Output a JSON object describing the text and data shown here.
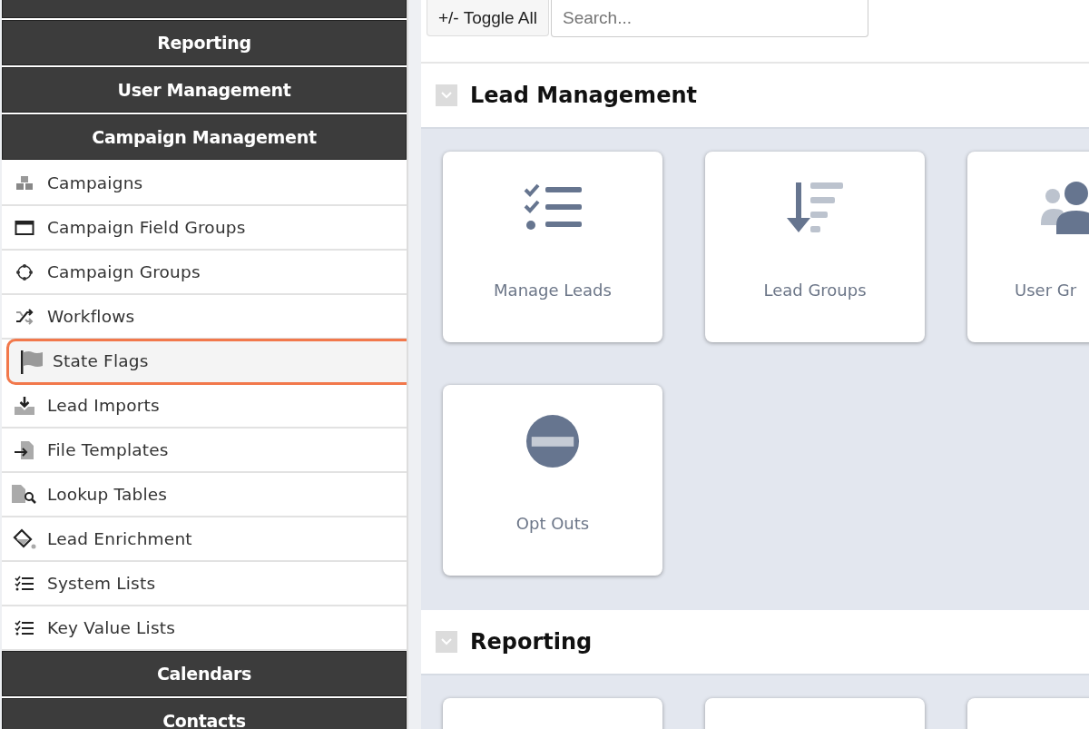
{
  "sidebar": {
    "groups": [
      {
        "kind": "cut"
      },
      {
        "title": "Reporting"
      },
      {
        "title": "User Management"
      },
      {
        "title": "Campaign Management",
        "items": [
          {
            "label": "Campaigns",
            "kind": "campaigns",
            "highlighted": false
          },
          {
            "label": "Campaign Field Groups",
            "kind": "window",
            "highlighted": false
          },
          {
            "label": "Campaign Groups",
            "kind": "groups",
            "highlighted": false
          },
          {
            "label": "Workflows",
            "kind": "shuffle",
            "highlighted": false
          },
          {
            "label": "State Flags",
            "kind": "flag",
            "highlighted": true
          },
          {
            "label": "Lead Imports",
            "kind": "import",
            "highlighted": false
          },
          {
            "label": "File Templates",
            "kind": "file",
            "highlighted": false
          },
          {
            "label": "Lookup Tables",
            "kind": "lookup",
            "highlighted": false
          },
          {
            "label": "Lead Enrichment",
            "kind": "paint",
            "highlighted": false
          },
          {
            "label": "System Lists",
            "kind": "list",
            "highlighted": false
          },
          {
            "label": "Key Value Lists",
            "kind": "list",
            "highlighted": false
          }
        ]
      },
      {
        "title": "Calendars"
      },
      {
        "title": "Contacts"
      }
    ]
  },
  "toolbar": {
    "toggle_button": "+/- Toggle All",
    "search": {
      "placeholder": "Search..."
    }
  },
  "sections": [
    {
      "title": "Lead Management",
      "expanded": true,
      "cards": [
        {
          "label": "Manage Leads",
          "kind": "checklist"
        },
        {
          "label": "Lead Groups",
          "kind": "sort"
        },
        {
          "label": "User Gr",
          "kind": "users",
          "clipped": true
        },
        {
          "label": "Opt Outs",
          "kind": "block"
        }
      ]
    },
    {
      "title": "Reporting",
      "expanded": true,
      "cards": [
        {
          "kind": "blank"
        },
        {
          "kind": "blank"
        },
        {
          "kind": "blank"
        }
      ]
    }
  ]
}
